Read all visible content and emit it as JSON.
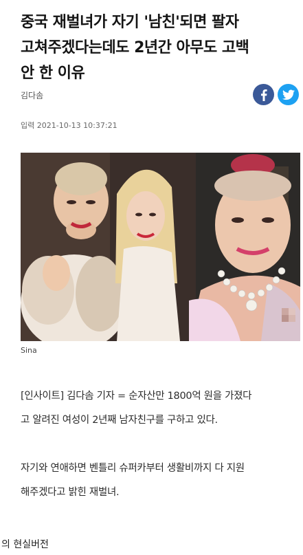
{
  "article": {
    "headline_lines": [
      "중국 재벌녀가 자기 '남친'되면 팔자",
      "고쳐주겠다는데도 2년간 아무도 고백",
      "안 한 이유"
    ],
    "author": "김다솜",
    "date_label": "입력",
    "date_value": "2021-10-13 10:37:21",
    "share_icons": [
      "facebook-icon",
      "twitter-icon"
    ],
    "photo_credit": "Sina",
    "paragraphs": [
      [
        "[인사이트] 김다솜 기자 = 순자산만 1800억 원을 가졌다",
        "고 알려진 여성이 2년째 남자친구를 구하고 있다."
      ],
      [
        "자기와 연애하면 벤틀리 슈퍼카부터 생활비까지 다 지원",
        "해주겠다고 밝힌 재벌녀."
      ]
    ]
  },
  "caption": "의 현실버전",
  "colors": {
    "facebook": "#3b5998",
    "twitter": "#1da1f2"
  }
}
